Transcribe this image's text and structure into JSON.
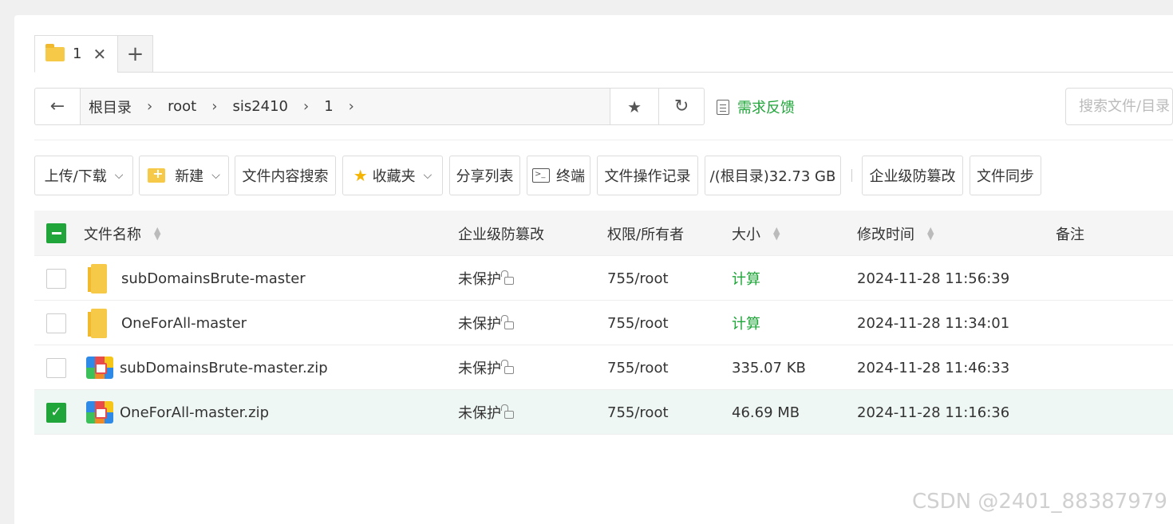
{
  "tabs": [
    {
      "label": "1"
    }
  ],
  "pathbar": {
    "crumbs": [
      "根目录",
      "root",
      "sis2410",
      "1"
    ]
  },
  "feedback_label": "需求反馈",
  "search_placeholder": "搜索文件/目录",
  "toolbar": {
    "upload_download": "上传/下载",
    "new": "新建",
    "content_search": "文件内容搜索",
    "favorites": "收藏夹",
    "share_list": "分享列表",
    "terminal": "终端",
    "op_log": "文件操作记录",
    "disk_usage": "/(根目录)32.73 GB",
    "tamper_protect": "企业级防篡改",
    "file_sync": "文件同步"
  },
  "table": {
    "headers": {
      "name": "文件名称",
      "protect": "企业级防篡改",
      "perm": "权限/所有者",
      "size": "大小",
      "mtime": "修改时间",
      "note": "备注"
    },
    "rows": [
      {
        "name": "subDomainsBrute-master",
        "type": "folder",
        "protect": "未保护",
        "perm": "755/root",
        "size": "计算",
        "mtime": "2024-11-28 11:56:39",
        "selected": false
      },
      {
        "name": "OneForAll-master",
        "type": "folder",
        "protect": "未保护",
        "perm": "755/root",
        "size": "计算",
        "mtime": "2024-11-28 11:34:01",
        "selected": false
      },
      {
        "name": "subDomainsBrute-master.zip",
        "type": "zip",
        "protect": "未保护",
        "perm": "755/root",
        "size": "335.07 KB",
        "mtime": "2024-11-28 11:46:33",
        "selected": false
      },
      {
        "name": "OneForAll-master.zip",
        "type": "zip",
        "protect": "未保护",
        "perm": "755/root",
        "size": "46.69 MB",
        "mtime": "2024-11-28 11:16:36",
        "selected": true
      }
    ]
  },
  "watermark": "CSDN @2401_88387979",
  "colors": {
    "accent": "#20a53a",
    "folder": "#f7c948",
    "selected_row": "#eef7f3"
  }
}
